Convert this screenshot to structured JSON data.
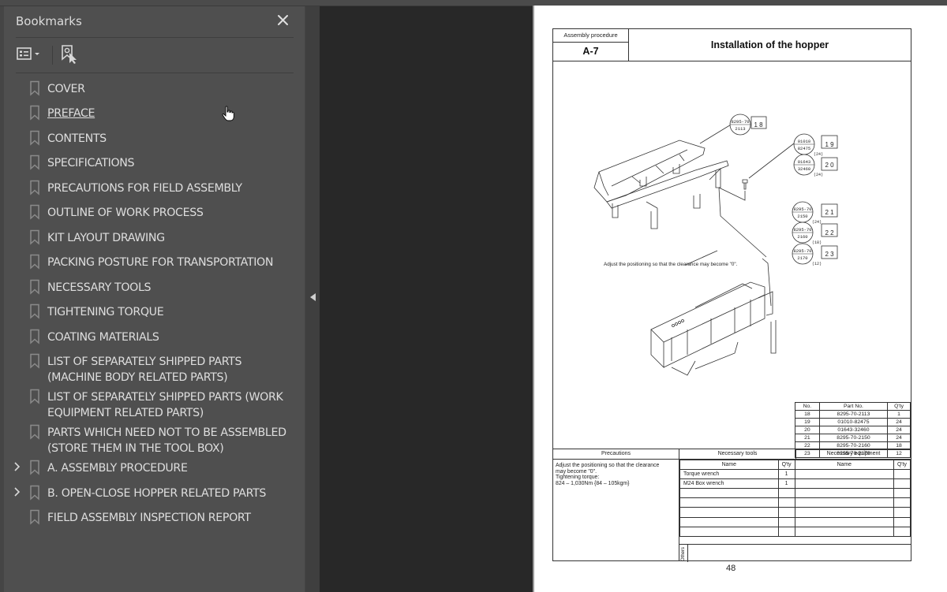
{
  "panel": {
    "title": "Bookmarks",
    "close_icon": "close-icon",
    "options_icon": "bookmark-options-icon",
    "find_icon": "find-current-bookmark-icon"
  },
  "bookmarks": [
    {
      "label": "COVER",
      "expandable": false
    },
    {
      "label": "PREFACE",
      "expandable": false,
      "hovered": true
    },
    {
      "label": "CONTENTS",
      "expandable": false
    },
    {
      "label": "SPECIFICATIONS",
      "expandable": false
    },
    {
      "label": "PRECAUTIONS FOR FIELD ASSEMBLY",
      "expandable": false
    },
    {
      "label": "OUTLINE OF WORK PROCESS",
      "expandable": false
    },
    {
      "label": "KIT LAYOUT DRAWING",
      "expandable": false
    },
    {
      "label": "PACKING POSTURE FOR TRANSPORTATION",
      "expandable": false
    },
    {
      "label": "NECESSARY TOOLS",
      "expandable": false
    },
    {
      "label": "TIGHTENING TORQUE",
      "expandable": false
    },
    {
      "label": "COATING MATERIALS",
      "expandable": false
    },
    {
      "label": "LIST OF SEPARATELY SHIPPED PARTS (MACHINE BODY RELATED PARTS)",
      "expandable": false
    },
    {
      "label": "LIST OF SEPARATELY SHIPPED PARTS (WORK EQUIPMENT RELATED PARTS)",
      "expandable": false
    },
    {
      "label": "PARTS WHICH NEED NOT TO BE ASSEMBLED (STORE THEM IN THE TOOL BOX)",
      "expandable": false
    },
    {
      "label": "A. ASSEMBLY PROCEDURE",
      "expandable": true
    },
    {
      "label": "B. OPEN-CLOSE HOPPER RELATED PARTS",
      "expandable": true
    },
    {
      "label": "FIELD ASSEMBLY INSPECTION REPORT",
      "expandable": false
    }
  ],
  "page": {
    "header_label": "Assembly procedure",
    "procedure_id": "A-7",
    "title": "Installation of the hopper",
    "drawing_note": "Adjust the positioning so that the clearance may become \"0\".",
    "callouts": [
      {
        "part": "8295-70 2113",
        "no": "1 8"
      },
      {
        "part": "01010 82475",
        "qty": "(24)",
        "no": "1 9"
      },
      {
        "part": "01643 32460",
        "qty": "(24)",
        "no": "2 0"
      },
      {
        "part": "8295-70 2150",
        "qty": "(24)",
        "no": "2 1"
      },
      {
        "part": "8295-70 2160",
        "qty": "(18)",
        "no": "2 2"
      },
      {
        "part": "8295-70 2170",
        "qty": "(12)",
        "no": "2 3"
      }
    ],
    "parts_table": {
      "headers": [
        "No.",
        "Part No.",
        "Q'ty"
      ],
      "rows": [
        [
          "18",
          "8295-70-2113",
          "1"
        ],
        [
          "19",
          "01010-82475",
          "24"
        ],
        [
          "20",
          "01643-32460",
          "24"
        ],
        [
          "21",
          "8295-70-2150",
          "24"
        ],
        [
          "22",
          "8295-70-2160",
          "18"
        ],
        [
          "23",
          "8295-70-2170",
          "12"
        ]
      ]
    },
    "precautions_header": "Precautions",
    "precautions_lines": [
      "Adjust the positioning so that the clearance",
      "may become \"0\".",
      "Tightening torque:",
      "824 – 1,030Nm {84 – 105kgm}"
    ],
    "tools_header": "Necessary tools",
    "equipment_header": "Necessary equipment",
    "grid_headers": [
      "Name",
      "Q'ty",
      "Name",
      "Q'ty"
    ],
    "tools": [
      {
        "name": "Torque wrench",
        "qty": "1"
      },
      {
        "name": "M24 Box wrench",
        "qty": "1"
      },
      {
        "name": "",
        "qty": ""
      },
      {
        "name": "",
        "qty": ""
      },
      {
        "name": "",
        "qty": ""
      },
      {
        "name": "",
        "qty": ""
      },
      {
        "name": "",
        "qty": ""
      }
    ],
    "others_label": "Others",
    "page_number": "48"
  }
}
